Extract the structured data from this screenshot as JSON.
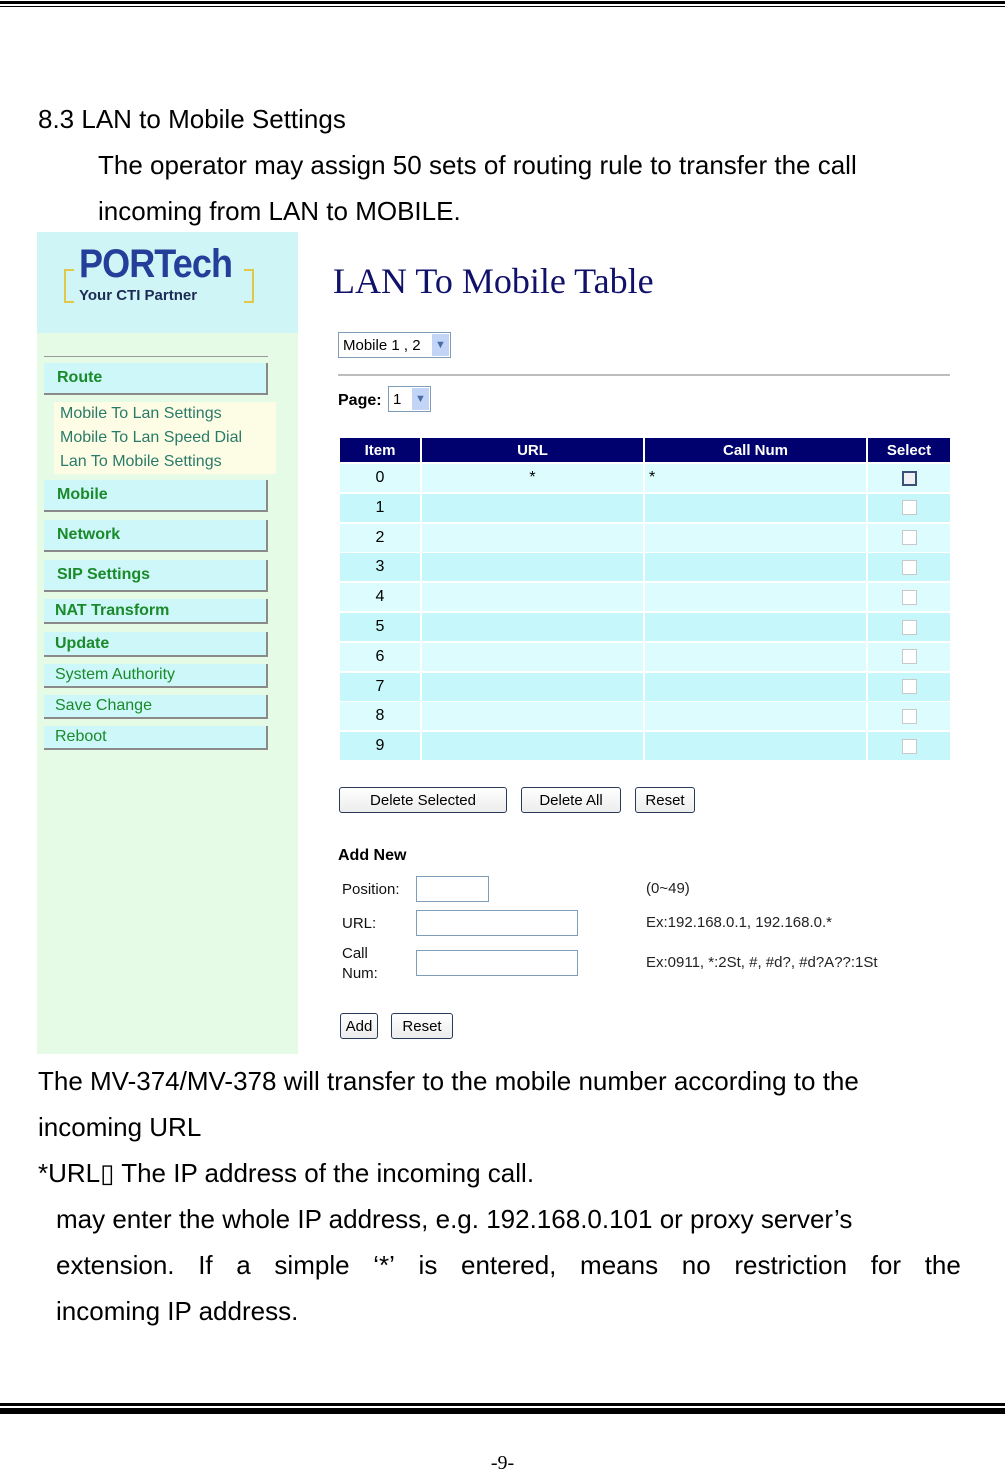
{
  "document": {
    "section_title": "8.3 LAN to Mobile Settings",
    "intro_line_1": "The operator may assign 50 sets of  routing rule to transfer the call",
    "intro_line_2": "incoming from LAN to MOBILE.",
    "after_line_1": "The MV-374/MV-378 will transfer to the mobile number according to the",
    "after_line_2": "incoming URL",
    "after_line_3": "*URL▯ The IP address of the incoming call.",
    "after_line_4": "may enter the whole IP address, e.g. 192.168.0.101 or proxy server’s",
    "after_line_5_words": [
      "extension.",
      "If",
      "a",
      "simple",
      "‘*’",
      "is",
      "entered,",
      "means",
      "no",
      "restriction",
      "for",
      "the"
    ],
    "after_line_6": "incoming IP address.",
    "page_number": "-9-"
  },
  "screenshot": {
    "logo": {
      "main": "PORTech",
      "sub": "Your CTI Partner",
      "bracket_color": "#e2c84a",
      "text_color": "#243f9a"
    },
    "sidebar": {
      "items": [
        {
          "label": "Route",
          "style": "bold"
        },
        {
          "label": "Mobile",
          "style": "bold"
        },
        {
          "label": "Network",
          "style": "bold"
        },
        {
          "label": "SIP Settings",
          "style": "bold"
        },
        {
          "label": "NAT Transform",
          "style": "bold"
        },
        {
          "label": "Update",
          "style": "bold"
        },
        {
          "label": "System Authority",
          "style": "light"
        },
        {
          "label": "Save Change",
          "style": "light"
        },
        {
          "label": "Reboot",
          "style": "light"
        }
      ],
      "route_submenu": [
        "Mobile To Lan Settings",
        "Mobile To Lan Speed Dial",
        "Lan To Mobile Settings"
      ]
    },
    "main": {
      "title": "LAN To Mobile Table",
      "mobile_select": {
        "value": "Mobile 1 , 2"
      },
      "page_label": "Page:",
      "page_select": {
        "value": "1"
      },
      "table": {
        "columns": [
          "Item",
          "URL",
          "Call Num",
          "Select"
        ],
        "rows": [
          {
            "item": "0",
            "url": "*",
            "call_num": "*",
            "selected": false
          },
          {
            "item": "1",
            "url": "",
            "call_num": "",
            "selected": false
          },
          {
            "item": "2",
            "url": "",
            "call_num": "",
            "selected": false
          },
          {
            "item": "3",
            "url": "",
            "call_num": "",
            "selected": false
          },
          {
            "item": "4",
            "url": "",
            "call_num": "",
            "selected": false
          },
          {
            "item": "5",
            "url": "",
            "call_num": "",
            "selected": false
          },
          {
            "item": "6",
            "url": "",
            "call_num": "",
            "selected": false
          },
          {
            "item": "7",
            "url": "",
            "call_num": "",
            "selected": false
          },
          {
            "item": "8",
            "url": "",
            "call_num": "",
            "selected": false
          },
          {
            "item": "9",
            "url": "",
            "call_num": "",
            "selected": false
          }
        ]
      },
      "buttons": {
        "delete_selected": "Delete Selected",
        "delete_all": "Delete All",
        "reset": "Reset"
      },
      "add_new": {
        "heading": "Add New",
        "position_label": "Position:",
        "position_value": "",
        "position_hint": "(0~49)",
        "url_label": "URL:",
        "url_value": "",
        "url_hint": "Ex:192.168.0.1,  192.168.0.*",
        "callnum_label_1": "Call",
        "callnum_label_2": "Num:",
        "callnum_value": "",
        "callnum_hint": "Ex:0911,  *:2St,  #, #d?, #d?A??:1St",
        "add_button": "Add",
        "reset_button": "Reset"
      }
    },
    "colors": {
      "header_bg": "#00006e",
      "row_light": "#dcfcfd",
      "row_dark": "#c6f8fb",
      "nav_text": "#1a8a2a",
      "title": "#11116a"
    }
  }
}
